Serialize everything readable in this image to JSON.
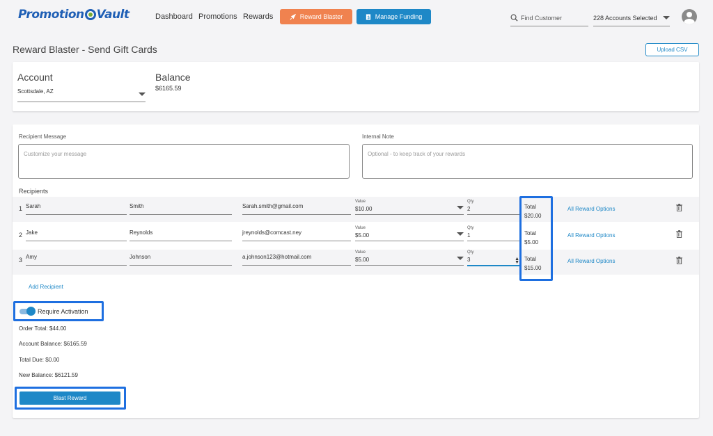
{
  "brand": {
    "logo_left": "Promotion",
    "logo_right": "Vault"
  },
  "nav": {
    "dashboard": "Dashboard",
    "promotions": "Promotions",
    "rewards": "Rewards"
  },
  "buttons": {
    "reward_blaster": "Reward Blaster",
    "manage_funding": "Manage Funding",
    "upload_csv": "Upload CSV",
    "blast_reward": "Blast Reward"
  },
  "search": {
    "placeholder": "Find Customer"
  },
  "accounts_selected": "228 Accounts Selected",
  "page_title": "Reward Blaster - Send Gift Cards",
  "account": {
    "label": "Account",
    "value": "Scottsdale, AZ"
  },
  "balance": {
    "label": "Balance",
    "value": "$6165.59"
  },
  "message": {
    "label": "Recipient Message",
    "placeholder": "Customize your message"
  },
  "note": {
    "label": "Internal Note",
    "placeholder": "Optional - to keep track of your rewards"
  },
  "recipients_label": "Recipients",
  "value_label": "Value",
  "qty_label": "Qty",
  "total_label": "Total",
  "reward_options_label": "All Reward Options",
  "recipients": [
    {
      "num": "1",
      "first": "Sarah",
      "last": "Smith",
      "email": "Sarah.smith@gmail.com",
      "value": "$10.00",
      "qty": "2",
      "total": "$20.00"
    },
    {
      "num": "2",
      "first": "Jake",
      "last": "Reynolds",
      "email": "jreynolds@comcast.ney",
      "value": "$5.00",
      "qty": "1",
      "total": "$5.00"
    },
    {
      "num": "3",
      "first": "Amy",
      "last": "Johnson",
      "email": "a.johnson123@hotmail.com",
      "value": "$5.00",
      "qty": "3",
      "total": "$15.00"
    }
  ],
  "add_recipient": "Add Recipient",
  "require_activation": "Require Activation",
  "summary": {
    "order_total": "Order Total: $44.00",
    "account_balance": "Account Balance: $6165.59",
    "total_due": "Total Due: $0.00",
    "new_balance": "New Balance: $6121.59"
  },
  "colors": {
    "primary": "#1e88c7",
    "orange": "#f0824f",
    "highlight": "#1e6fe0"
  }
}
